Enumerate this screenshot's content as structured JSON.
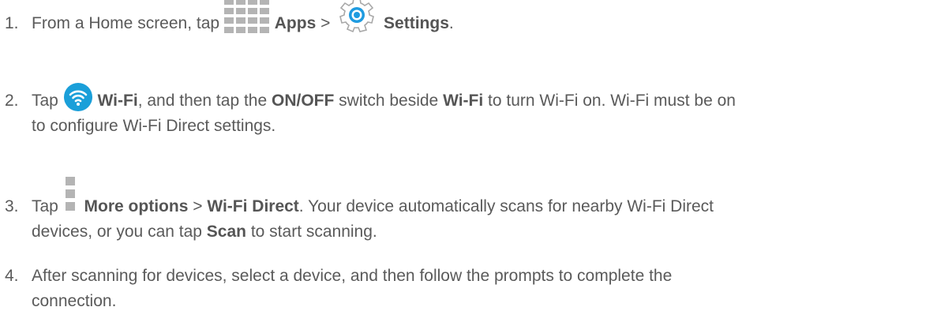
{
  "steps": [
    {
      "num": "1.",
      "t1": "From a Home screen, tap ",
      "apps_label": "Apps",
      "sep": " > ",
      "settings_label": "Settings",
      "end": "."
    },
    {
      "num": "2.",
      "t1": "Tap ",
      "wifi_label": "Wi-Fi",
      "t2": ", and then tap the ",
      "onoff_label": "ON/OFF",
      "t3": " switch beside ",
      "wifi_label_2": "Wi-Fi",
      "t4": " to turn Wi-Fi on. Wi-Fi must be on",
      "line2": "to configure Wi-Fi Direct settings."
    },
    {
      "num": "3.",
      "t1": "Tap ",
      "more_label": "More options",
      "sep": " > ",
      "direct_label": "Wi-Fi Direct",
      "t2": ". Your device automatically scans for nearby Wi-Fi Direct",
      "line2a": "devices, or you can tap ",
      "scan_label": "Scan",
      "line2b": " to start scanning."
    },
    {
      "num": "4.",
      "t1": "After scanning for devices, select a device, and then follow the prompts to complete the",
      "line2": "connection."
    }
  ],
  "icons": {
    "apps": "apps-grid-icon",
    "settings": "settings-gear-icon",
    "wifi": "wifi-icon",
    "more": "more-options-icon"
  },
  "colors": {
    "text": "#5a5a5a",
    "icon_gray": "#b4b4b4",
    "wifi_blue": "#1a9fd9",
    "gear_blue": "#1e9be0"
  }
}
